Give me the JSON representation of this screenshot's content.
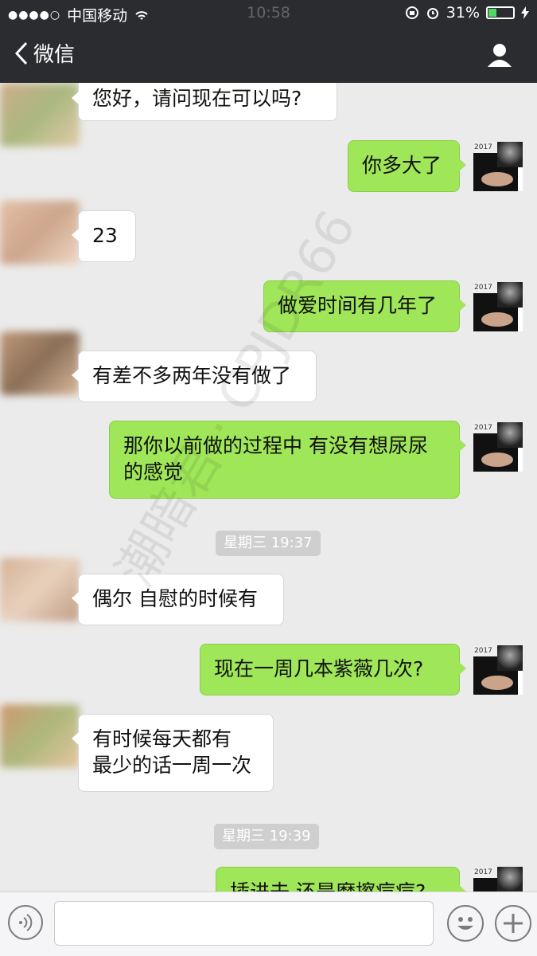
{
  "status_bar": {
    "signal": "●●●●○",
    "carrier": "中国移动",
    "time": "10:58",
    "battery_text": "31%",
    "battery_level": 0.31
  },
  "nav": {
    "back_label": "微信"
  },
  "messages": [
    {
      "side": "in",
      "text": "您好，请问现在可以吗?"
    },
    {
      "side": "out",
      "text": "你多大了"
    },
    {
      "side": "in",
      "text": "23"
    },
    {
      "side": "out",
      "text": "做爱时间有几年了"
    },
    {
      "side": "in",
      "text": "有差不多两年没有做了"
    },
    {
      "side": "out",
      "text": "那你以前做的过程中 有没有想尿尿的感觉"
    },
    {
      "side": "in",
      "text": "偶尔 自慰的时候有"
    },
    {
      "side": "out",
      "text": "现在一周几本紫薇几次?"
    },
    {
      "side": "in",
      "text": "有时候每天都有\n最少的话一周一次"
    },
    {
      "side": "out",
      "text": "插进去 还是磨擦痘痘?"
    }
  ],
  "timestamps": [
    "星期三 19:37",
    "星期三 19:39"
  ],
  "avatar_year": "2017",
  "watermark": "潮暗君 · CPJDR66",
  "colors": {
    "bar": "#2b2c30",
    "chat_bg": "#ebebeb",
    "out_bubble": "#9fe658",
    "in_bubble": "#ffffff"
  }
}
